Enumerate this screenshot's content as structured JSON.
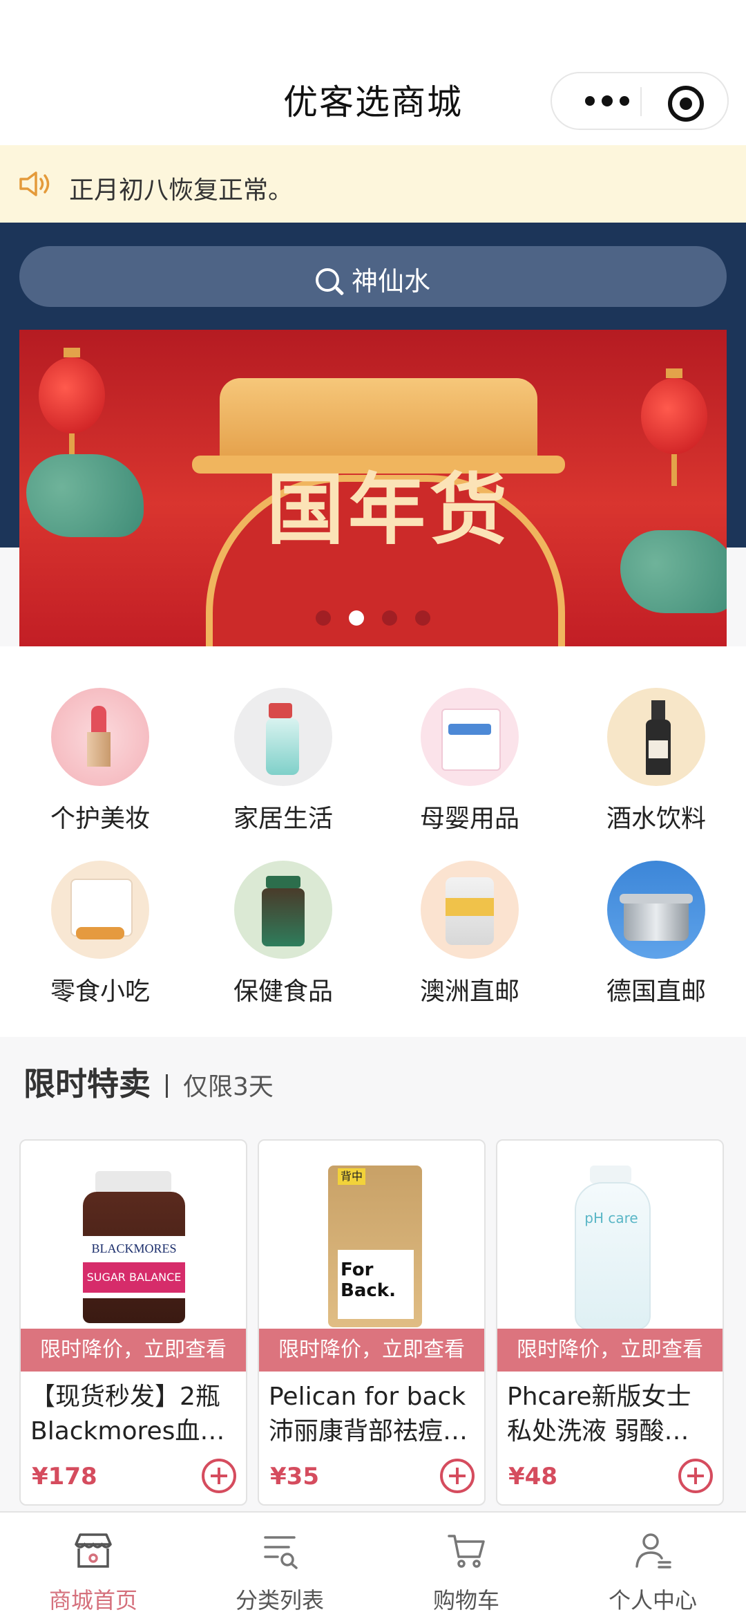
{
  "app": {
    "title": "优客选商城"
  },
  "notice": {
    "text": "正月初八恢复正常。"
  },
  "search": {
    "placeholder": "神仙水"
  },
  "banner": {
    "headline": "国年货",
    "slides": 4,
    "active_slide": 2
  },
  "categories": [
    {
      "label": "个护美妆",
      "icon": "lipstick-icon"
    },
    {
      "label": "家居生活",
      "icon": "spray-bottle-icon"
    },
    {
      "label": "母婴用品",
      "icon": "diapers-icon"
    },
    {
      "label": "酒水饮料",
      "icon": "wine-icon"
    },
    {
      "label": "零食小吃",
      "icon": "snack-icon"
    },
    {
      "label": "保健食品",
      "icon": "supplement-icon"
    },
    {
      "label": "澳洲直邮",
      "icon": "milk-powder-icon"
    },
    {
      "label": "德国直邮",
      "icon": "cooking-pot-icon"
    }
  ],
  "flash_sale": {
    "title": "限时特卖",
    "subtitle": "仅限3天",
    "items": [
      {
        "promo": "限时降价，立即查看",
        "name_line1": "【现货秒发】2瓶",
        "name_line2": "Blackmores血…",
        "price": "¥178",
        "image_text": "BLACKMORES",
        "image_sub": "SUGAR BALANCE"
      },
      {
        "promo": "限时降价，立即查看",
        "name_line1": "Pelican for back",
        "name_line2": "沛丽康背部祛痘…",
        "price": "¥35",
        "image_text": "For Back.",
        "image_sub": "背中"
      },
      {
        "promo": "限时降价，立即查看",
        "name_line1": "Phcare新版女士",
        "name_line2": "私处洗液 弱酸…",
        "price": "¥48",
        "image_text": "pH care",
        "image_sub": ""
      }
    ]
  },
  "tabs": [
    {
      "label": "商城首页",
      "icon": "store-icon",
      "active": true
    },
    {
      "label": "分类列表",
      "icon": "category-list-icon",
      "active": false
    },
    {
      "label": "购物车",
      "icon": "cart-icon",
      "active": false
    },
    {
      "label": "个人中心",
      "icon": "profile-icon",
      "active": false
    }
  ],
  "colors": {
    "accent": "#d5707c",
    "header_band": "#1c3559",
    "notice_bg": "#fdf6dc",
    "price": "#d54c5e"
  }
}
